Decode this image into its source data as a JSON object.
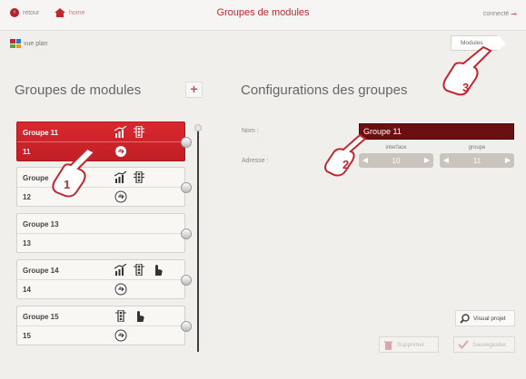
{
  "topbar": {
    "back_label": "retour",
    "home_label": "home",
    "title": "Groupes de modules",
    "connection_status": "connecté"
  },
  "subnav": {
    "plan_label": "vue plan",
    "modules_tab": "Modules"
  },
  "left_panel": {
    "title": "Groupes de modules",
    "add_icon": "plus-icon",
    "groups": [
      {
        "name": "Groupe 11",
        "address": "11",
        "icons": [
          "dimmer-icon",
          "traffic-light-icon"
        ],
        "selected": true
      },
      {
        "name": "Groupe",
        "address": "12",
        "icons": [
          "dimmer-icon",
          "traffic-light-icon"
        ],
        "selected": false
      },
      {
        "name": "Groupe 13",
        "address": "13",
        "icons": [],
        "selected": false
      },
      {
        "name": "Groupe 14",
        "address": "14",
        "icons": [
          "dimmer-icon",
          "traffic-light-icon",
          "hand-icon"
        ],
        "selected": false
      },
      {
        "name": "Groupe  15",
        "address": "15",
        "icons": [
          "traffic-light-icon",
          "hand-icon"
        ],
        "selected": false
      }
    ]
  },
  "right_panel": {
    "title": "Configurations des groupes",
    "nom_label": "Nom :",
    "nom_value": "Groupe 11",
    "adresse_label": "Adresse :",
    "interface_label": "interface",
    "interface_value": "10",
    "groupe_label": "groupe",
    "groupe_value": "11",
    "visual_button": "Visual projet",
    "delete_button": "Supprimer",
    "save_button": "Sauvegarder"
  },
  "callouts": [
    "1",
    "2",
    "3"
  ],
  "colors": {
    "accent": "#c3262f",
    "selected_row": "#d9282f",
    "name_field": "#6b1010",
    "stepper": "#c9c4be"
  }
}
